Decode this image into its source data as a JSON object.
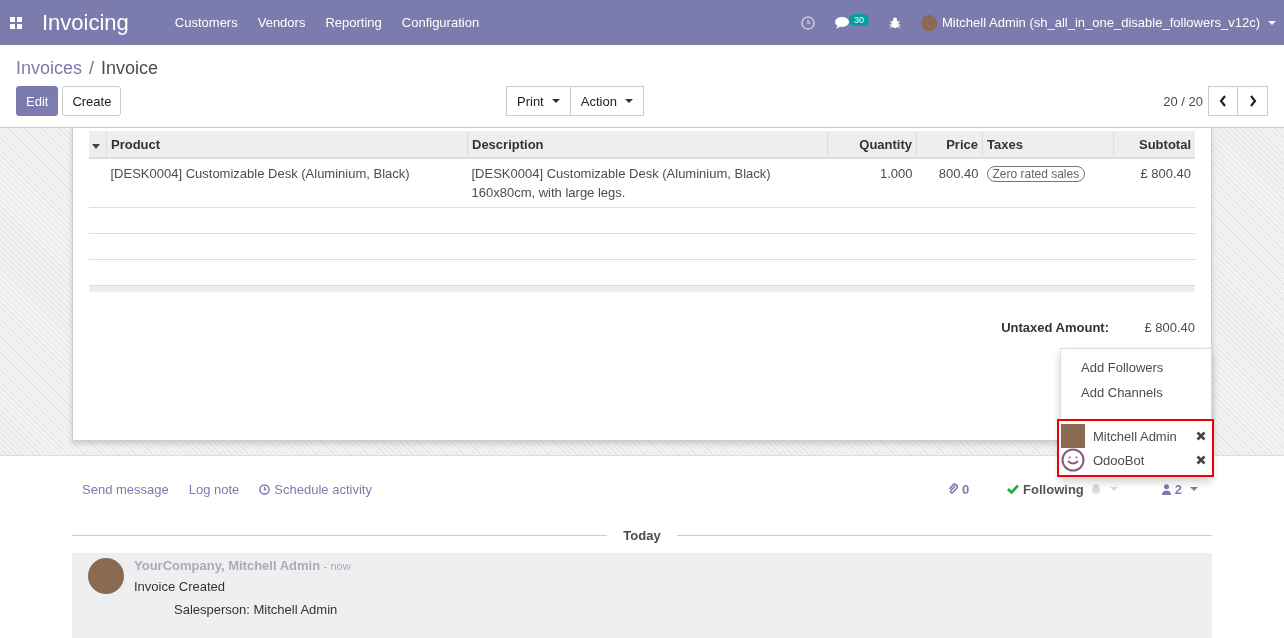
{
  "navbar": {
    "app_title": "Invoicing",
    "menu": [
      "Customers",
      "Vendors",
      "Reporting",
      "Configuration"
    ],
    "message_count": "30",
    "user": "Mitchell Admin (sh_all_in_one_disable_followers_v12c)"
  },
  "breadcrumb": {
    "parent": "Invoices",
    "separator": "/",
    "current": "Invoice"
  },
  "buttons": {
    "edit": "Edit",
    "create": "Create",
    "print": "Print",
    "action": "Action"
  },
  "pager": "20 / 20",
  "table": {
    "columns": [
      "Product",
      "Description",
      "Quantity",
      "Price",
      "Taxes",
      "Subtotal"
    ],
    "rows": [
      {
        "product": "[DESK0004] Customizable Desk (Aluminium, Black)",
        "description": "[DESK0004] Customizable Desk (Aluminium, Black)\n160x80cm, with large legs.",
        "quantity": "1.000",
        "price": "800.40",
        "tax": "Zero rated sales",
        "subtotal": "£ 800.40"
      }
    ]
  },
  "totals": [
    {
      "label": "Untaxed Amount:",
      "value": "£ 800.40"
    }
  ],
  "followers_menu": {
    "actions": [
      "Add Followers",
      "Add Channels"
    ],
    "followers": [
      {
        "name": "Mitchell Admin",
        "kind": "user"
      },
      {
        "name": "OdooBot",
        "kind": "bot"
      }
    ]
  },
  "chatter": {
    "send_message": "Send message",
    "log_note": "Log note",
    "schedule_activity": "Schedule activity",
    "attachments": "0",
    "following": "Following",
    "followers_count": "2",
    "date_separator": "Today",
    "messages": [
      {
        "author": "YourCompany, Mitchell Admin",
        "time": "- now",
        "body": "Invoice Created",
        "detail": "Salesperson: Mitchell Admin"
      }
    ]
  }
}
